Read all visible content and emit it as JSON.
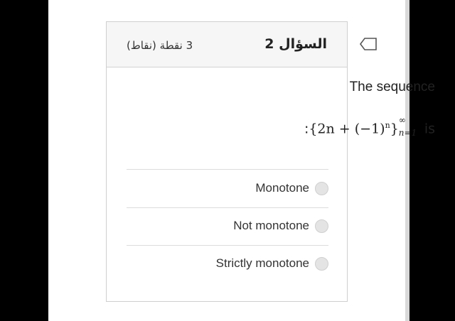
{
  "question": {
    "title": "السؤال 2",
    "points": "3 نقطة (نقاط)",
    "text": "The sequence",
    "formula_main": "{2n + (−1)",
    "formula_exp": "n",
    "formula_close": "}",
    "formula_sup": "∞",
    "formula_sub": "n=1",
    "formula_prefix": ":",
    "formula_suffix": " is"
  },
  "options": [
    {
      "label": "Monotone"
    },
    {
      "label": "Not monotone"
    },
    {
      "label": "Strictly monotone"
    }
  ],
  "colors": {
    "background": "#000000",
    "page": "#ffffff",
    "header": "#f6f6f6",
    "radio": "#e4e4e4"
  },
  "icons": {
    "flag": "flag-outline-icon"
  }
}
